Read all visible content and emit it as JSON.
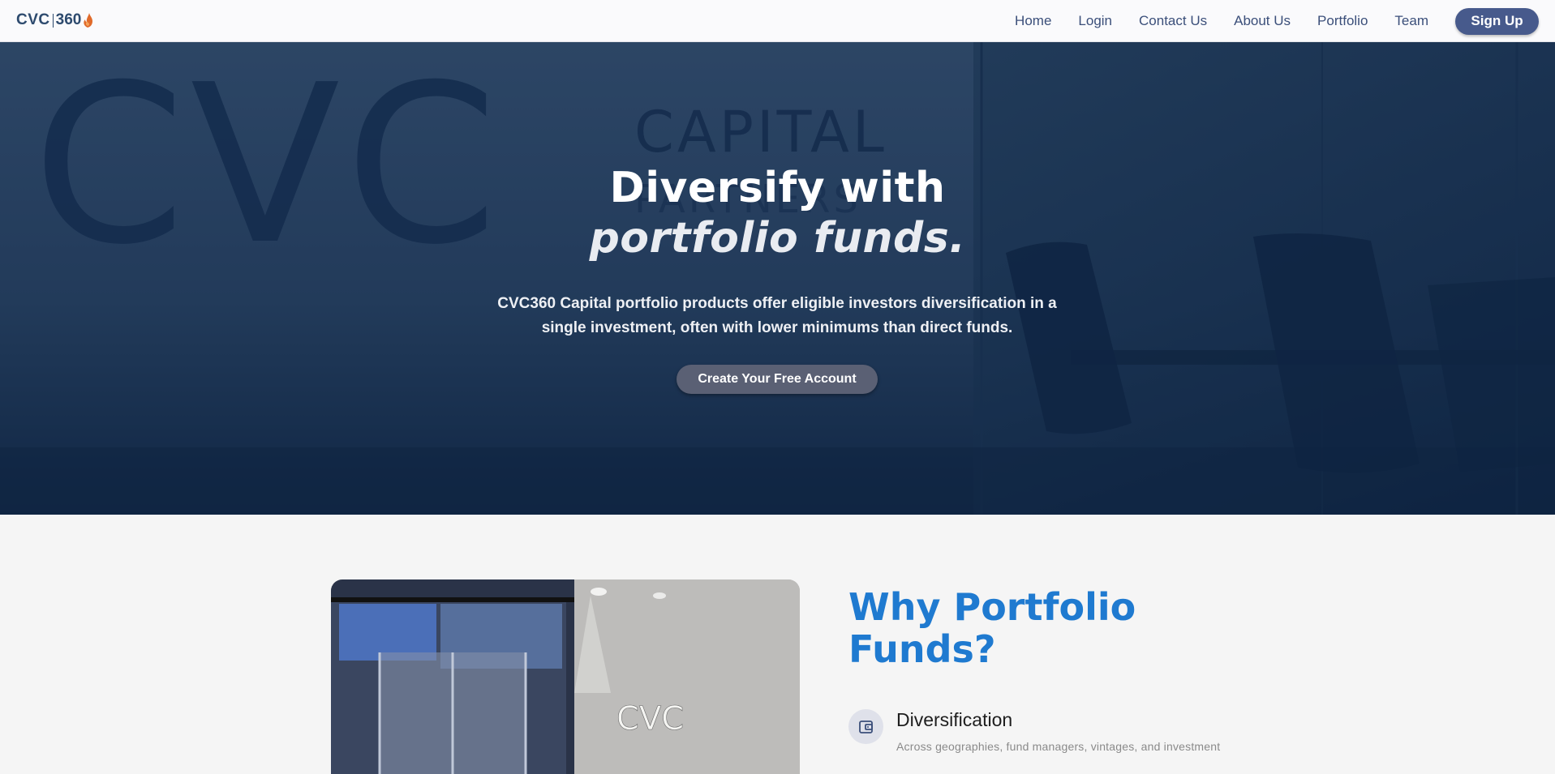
{
  "nav": {
    "logo": {
      "left": "CVC",
      "right": "360"
    },
    "links": [
      "Home",
      "Login",
      "Contact Us",
      "About Us",
      "Portfolio",
      "Team"
    ],
    "signup": "Sign Up"
  },
  "hero": {
    "bg_word_left": "CVC",
    "bg_word_capital": "CAPITAL",
    "bg_word_partners": "PARTNERS",
    "title_line1": "Diversify with",
    "title_line2": "portfolio funds.",
    "subtitle": "CVC360 Capital portfolio products offer eligible investors diversification in a single investment, often with lower minimums than direct funds.",
    "cta": "Create Your Free Account"
  },
  "why": {
    "image_sign": "CVC",
    "title": "Why Portfolio Funds?",
    "features": [
      {
        "icon": "wallet-icon",
        "title": "Diversification",
        "desc": "Across geographies, fund managers, vintages, and investment"
      }
    ]
  },
  "colors": {
    "accent": "#1f7ad0",
    "nav_text": "#3b4f7a",
    "signup_bg": "#475a8c",
    "hero_bg": "#213a58"
  }
}
